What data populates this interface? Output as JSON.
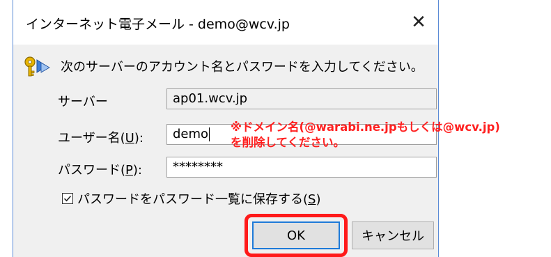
{
  "window": {
    "title": "インターネット電子メール - demo@wcv.jp",
    "close_glyph": "✕"
  },
  "prompt": {
    "icon": "key-icon",
    "text": "次のサーバーのアカウント名とパスワードを入力してください。"
  },
  "form": {
    "server_label": "サーバー",
    "server_value": "ap01.wcv.jp",
    "user_label_prefix": "ユーザー名(",
    "user_label_mnemonic": "U",
    "user_label_suffix": "):",
    "user_value": "demo",
    "password_label_prefix": "パスワード(",
    "password_label_mnemonic": "P",
    "password_label_suffix": "):",
    "password_value": "********"
  },
  "annotation": {
    "line1": "※ドメイン名(@warabi.ne.jpもしくは@wcv.jp)",
    "line2": "を削除してください。",
    "color": "#ff1f1f"
  },
  "remember": {
    "checked": true,
    "label_prefix": "パスワードをパスワード一覧に保存する(",
    "label_mnemonic": "S",
    "label_suffix": ")"
  },
  "buttons": {
    "ok_label": "OK",
    "cancel_label": "キャンセル"
  }
}
